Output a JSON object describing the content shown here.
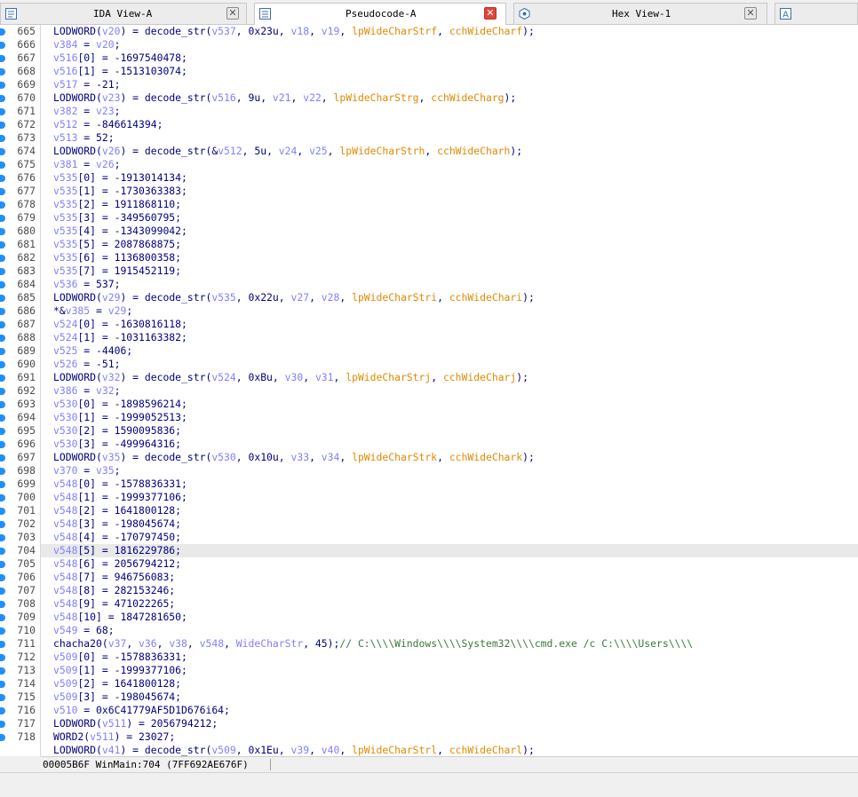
{
  "tabs": [
    {
      "label": "IDA View-A",
      "icon": "listing-icon",
      "active": false
    },
    {
      "label": "Pseudocode-A",
      "icon": "pseudocode-icon",
      "active": true
    },
    {
      "label": "Hex View-1",
      "icon": "hex-icon",
      "active": false
    },
    {
      "label": "",
      "icon": "structures-icon",
      "active": false
    }
  ],
  "lines": [
    {
      "n": "665",
      "code": "LODWORD(v20) = decode_str(v537, 0x23u, v18, v19, lpWideCharStrf, cchWideCharf);"
    },
    {
      "n": "666",
      "code": "v384 = v20;"
    },
    {
      "n": "667",
      "code": "v516[0] = -1697540478;"
    },
    {
      "n": "668",
      "code": "v516[1] = -1513103074;"
    },
    {
      "n": "669",
      "code": "v517 = -21;"
    },
    {
      "n": "670",
      "code": "LODWORD(v23) = decode_str(v516, 9u, v21, v22, lpWideCharStrg, cchWideCharg);"
    },
    {
      "n": "671",
      "code": "v382 = v23;"
    },
    {
      "n": "672",
      "code": "v512 = -846614394;"
    },
    {
      "n": "673",
      "code": "v513 = 52;"
    },
    {
      "n": "674",
      "code": "LODWORD(v26) = decode_str(&v512, 5u, v24, v25, lpWideCharStrh, cchWideCharh);"
    },
    {
      "n": "675",
      "code": "v381 = v26;"
    },
    {
      "n": "676",
      "code": "v535[0] = -1913014134;"
    },
    {
      "n": "677",
      "code": "v535[1] = -1730363383;"
    },
    {
      "n": "678",
      "code": "v535[2] = 1911868110;"
    },
    {
      "n": "679",
      "code": "v535[3] = -349560795;"
    },
    {
      "n": "680",
      "code": "v535[4] = -1343099042;"
    },
    {
      "n": "681",
      "code": "v535[5] = 2087868875;"
    },
    {
      "n": "682",
      "code": "v535[6] = 1136800358;"
    },
    {
      "n": "683",
      "code": "v535[7] = 1915452119;"
    },
    {
      "n": "684",
      "code": "v536 = 537;"
    },
    {
      "n": "685",
      "code": "LODWORD(v29) = decode_str(v535, 0x22u, v27, v28, lpWideCharStri, cchWideChari);"
    },
    {
      "n": "686",
      "code": "*&v385 = v29;"
    },
    {
      "n": "687",
      "code": "v524[0] = -1630816118;"
    },
    {
      "n": "688",
      "code": "v524[1] = -1031163382;"
    },
    {
      "n": "689",
      "code": "v525 = -4406;"
    },
    {
      "n": "690",
      "code": "v526 = -51;"
    },
    {
      "n": "691",
      "code": "LODWORD(v32) = decode_str(v524, 0xBu, v30, v31, lpWideCharStrj, cchWideCharj);"
    },
    {
      "n": "692",
      "code": "v386 = v32;"
    },
    {
      "n": "693",
      "code": "v530[0] = -1898596214;"
    },
    {
      "n": "694",
      "code": "v530[1] = -1999052513;"
    },
    {
      "n": "695",
      "code": "v530[2] = 1590095836;"
    },
    {
      "n": "696",
      "code": "v530[3] = -499964316;"
    },
    {
      "n": "697",
      "code": "LODWORD(v35) = decode_str(v530, 0x10u, v33, v34, lpWideCharStrk, cchWideChark);"
    },
    {
      "n": "698",
      "code": "v370 = v35;"
    },
    {
      "n": "699",
      "code": "v548[0] = -1578836331;"
    },
    {
      "n": "700",
      "code": "v548[1] = -1999377106;"
    },
    {
      "n": "701",
      "code": "v548[2] = 1641800128;"
    },
    {
      "n": "702",
      "code": "v548[3] = -198045674;"
    },
    {
      "n": "703",
      "code": "v548[4] = -170797450;"
    },
    {
      "n": "704",
      "code": "v548[5] = 1816229786;"
    },
    {
      "n": "705",
      "code": "v548[6] = 2056794212;"
    },
    {
      "n": "706",
      "code": "v548[7] = 946756083;"
    },
    {
      "n": "707",
      "code": "v548[8] = 282153246;"
    },
    {
      "n": "708",
      "code": "v548[9] = 471022265;"
    },
    {
      "n": "709",
      "code": "v548[10] = 1847281650;"
    },
    {
      "n": "710",
      "code": "v549 = 68;"
    },
    {
      "n": "711",
      "code": "chacha20(v37, v36, v38, v548, WideCharStr, 45);// C:\\\\\\\\Windows\\\\\\\\System32\\\\\\\\cmd.exe /c C:\\\\\\\\Users\\\\\\\\"
    },
    {
      "n": "712",
      "code": "v509[0] = -1578836331;"
    },
    {
      "n": "713",
      "code": "v509[1] = -1999377106;"
    },
    {
      "n": "714",
      "code": "v509[2] = 1641800128;"
    },
    {
      "n": "715",
      "code": "v509[3] = -198045674;"
    },
    {
      "n": "716",
      "code": "v510 = 0x6C41779AF5D1D676i64;"
    },
    {
      "n": "717",
      "code": "LODWORD(v511) = 2056794212;"
    },
    {
      "n": "718",
      "code": "WORD2(v511) = 23027;"
    },
    {
      "n": "",
      "code": "LODWORD(v41) = decode_str(v509, 0x1Eu, v39, v40, lpWideCharStrl, cchWideCharl);"
    }
  ],
  "highlighted_line": "704",
  "status": {
    "text": "00005B6F WinMain:704 (7FF692AE676F)"
  },
  "colors": {
    "function": "#000080",
    "variable": "#8080ff",
    "argument": "#e08a00",
    "comment": "#3a7a3a",
    "breakpoint": "#1e90ff",
    "active_close": "#e0443c"
  }
}
